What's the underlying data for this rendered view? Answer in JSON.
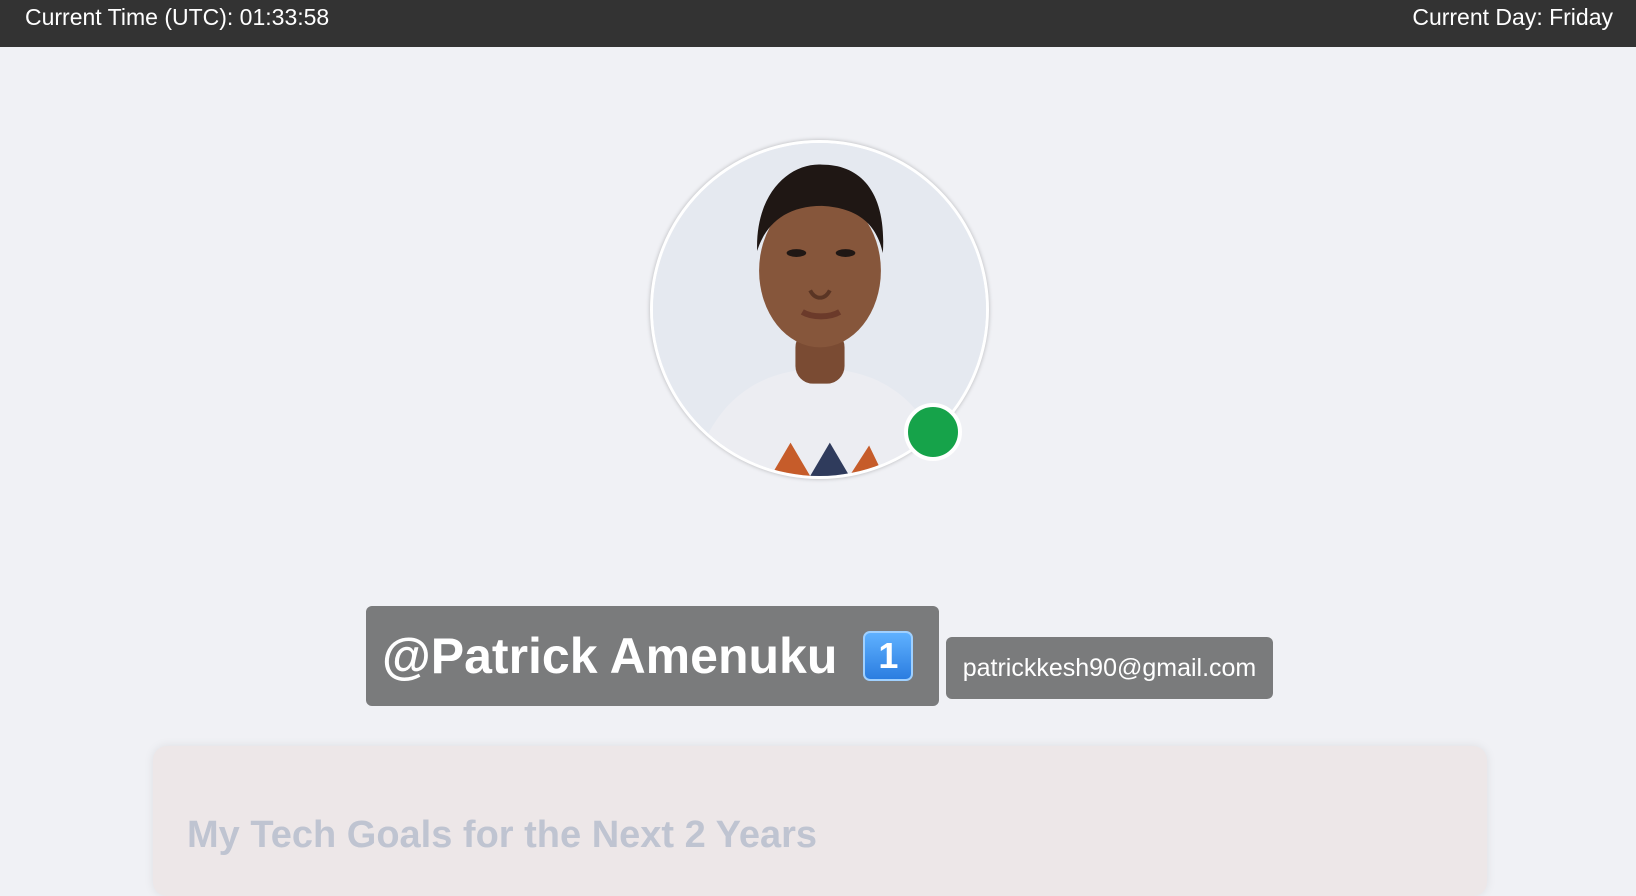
{
  "topbar": {
    "time_label": "Current Time (UTC): 01:33:58",
    "day_label": "Current Day: Friday"
  },
  "profile": {
    "name": "@Patrick Amenuku",
    "rank_badge": "1",
    "email": "patrickkesh90@gmail.com",
    "status": "online"
  },
  "goals": {
    "title": "My Tech Goals for the Next 2 Years"
  },
  "colors": {
    "topbar": "#333333",
    "background": "#f0f1f5",
    "badge": "#7a7b7c",
    "online_status": "#16a34a",
    "card": "#ede7e8"
  }
}
